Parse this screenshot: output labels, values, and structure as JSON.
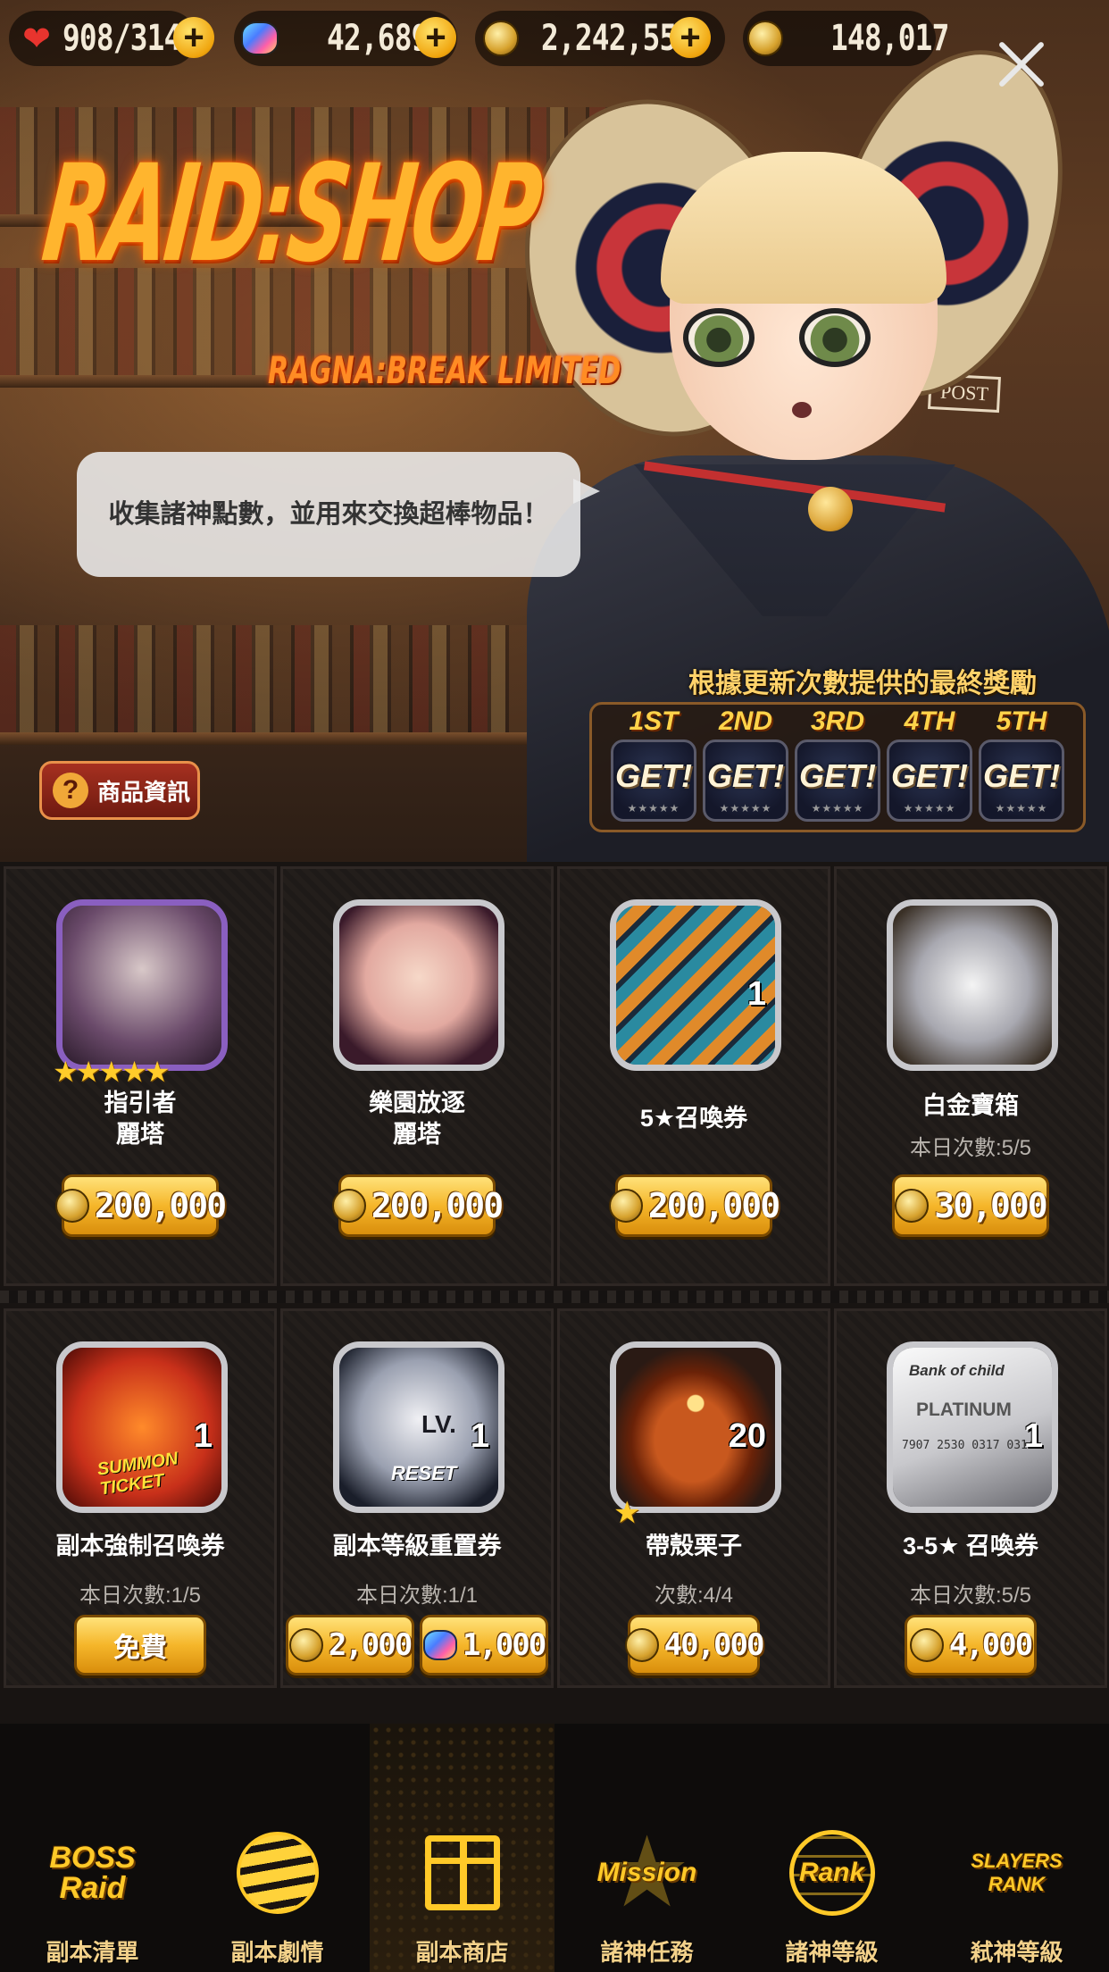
{
  "resources": {
    "stamina": {
      "icon": "heart-icon",
      "current": "908",
      "max": "/314"
    },
    "gems": {
      "icon": "rainbow-gem-icon",
      "value": "42,689"
    },
    "gold": {
      "icon": "gold-coin-icon",
      "value": "2,242,556"
    },
    "raid_points": {
      "icon": "raid-coin-icon",
      "value": "148,017"
    }
  },
  "hero": {
    "logo_main": "RAID:SHOP",
    "logo_sub": "RAGNA:BREAK LIMITED",
    "speech": "收集諸神點數，並用來交換超棒物品！",
    "post_sign": "POST",
    "info_button": "商品資訊",
    "info_icon": "?",
    "rewards_title": "根據更新次數提供的最終獎勵",
    "rewards": [
      {
        "rank": "1ST",
        "label": "GET!"
      },
      {
        "rank": "2ND",
        "label": "GET!"
      },
      {
        "rank": "3RD",
        "label": "GET!"
      },
      {
        "rank": "4TH",
        "label": "GET!"
      },
      {
        "rank": "5TH",
        "label": "GET!"
      }
    ],
    "reward_stars": "★★★★★"
  },
  "shop_items": [
    {
      "name_line1": "指引者",
      "name_line2": "麗塔",
      "sub": "",
      "price": "200,000",
      "stars": "★★★★★",
      "qty": ""
    },
    {
      "name_line1": "樂園放逐",
      "name_line2": "麗塔",
      "sub": "",
      "price": "200,000",
      "qty": ""
    },
    {
      "name_line1": "5★召喚券",
      "name_line2": "",
      "sub": "",
      "price": "200,000",
      "qty": "1"
    },
    {
      "name_line1": "白金寶箱",
      "name_line2": "",
      "sub": "本日次數:5/5",
      "price": "30,000",
      "qty": ""
    },
    {
      "name_line1": "副本強制召喚券",
      "sub": "本日次數:1/5",
      "price_free": "免費",
      "qty": "1"
    },
    {
      "name_line1": "副本等級重置券",
      "sub": "本日次數:1/1",
      "price": "2,000",
      "price_gem": "1,000",
      "qty": "1"
    },
    {
      "name_line1": "帶殼栗子",
      "sub": "次數:4/4",
      "price": "40,000",
      "qty": "20",
      "star": "★"
    },
    {
      "name_line1": "3-5★ 召喚券",
      "sub": "本日次數:5/5",
      "price": "4,000",
      "qty": "1"
    }
  ],
  "item_art": {
    "ticket_summon": "SUMMON TICKET",
    "ticket_reset_lv": "LV.",
    "ticket_reset": "RESET",
    "card_bank": "Bank of child",
    "card_platinum": "PLATINUM",
    "card_number": "7907 2530 0317 0314"
  },
  "nav": [
    {
      "label": "副本清單",
      "icon_text": "BOSS Raid",
      "icon": "boss-raid-icon"
    },
    {
      "label": "副本劇情",
      "icon_text": "",
      "icon": "story-orb-icon"
    },
    {
      "label": "副本商店",
      "icon_text": "",
      "icon": "gift-box-icon",
      "active": true
    },
    {
      "label": "諸神任務",
      "icon_text": "Mission",
      "icon": "mission-star-icon"
    },
    {
      "label": "諸神等級",
      "icon_text": "Rank",
      "icon": "rank-globe-icon"
    },
    {
      "label": "弒神等級",
      "icon_text": "SLAYERS RANK",
      "icon": "slayers-rank-icon"
    }
  ],
  "colors": {
    "gold_button": "#f5b62a",
    "accent_orange": "#ffb52e",
    "label_gold": "#f3d18a"
  }
}
